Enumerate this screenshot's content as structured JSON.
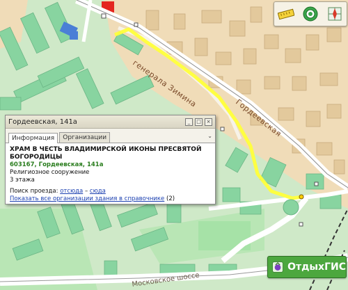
{
  "map": {
    "streets": {
      "zimina": "генерала Зимина",
      "gordeevskaya": "Гордеевская",
      "moskovskoe": "Московское шоссе"
    }
  },
  "toolbar": {
    "icons": [
      "ruler-icon",
      "location-target-icon",
      "compass-icon"
    ]
  },
  "popup": {
    "title": "Гордеевская, 141а",
    "tabs": [
      "Информация",
      "Организации"
    ],
    "org_name": "ХРАМ В ЧЕСТЬ ВЛАДИМИРСКОЙ ИКОНЫ ПРЕСВЯТОЙ БОГОРОДИЦЫ",
    "address": "603167, Гордеевская, 141а",
    "type": "Религиозное сооружение",
    "floors": "3 этажа",
    "route_label": "Поиск проезда:",
    "route_from": "отсюда",
    "route_dash": "–",
    "route_to": "сюда",
    "show_all": "Показать все организации здания в справочнике",
    "show_all_count": "(2)"
  },
  "badge": {
    "label": "ОтдыхГИС"
  },
  "colors": {
    "map_green": "#cfe9c8",
    "building_green": "#88d4a0",
    "residential_tan": "#f0dcb8",
    "route_yellow": "#ffff3a",
    "badge_green": "#4ca73e"
  }
}
